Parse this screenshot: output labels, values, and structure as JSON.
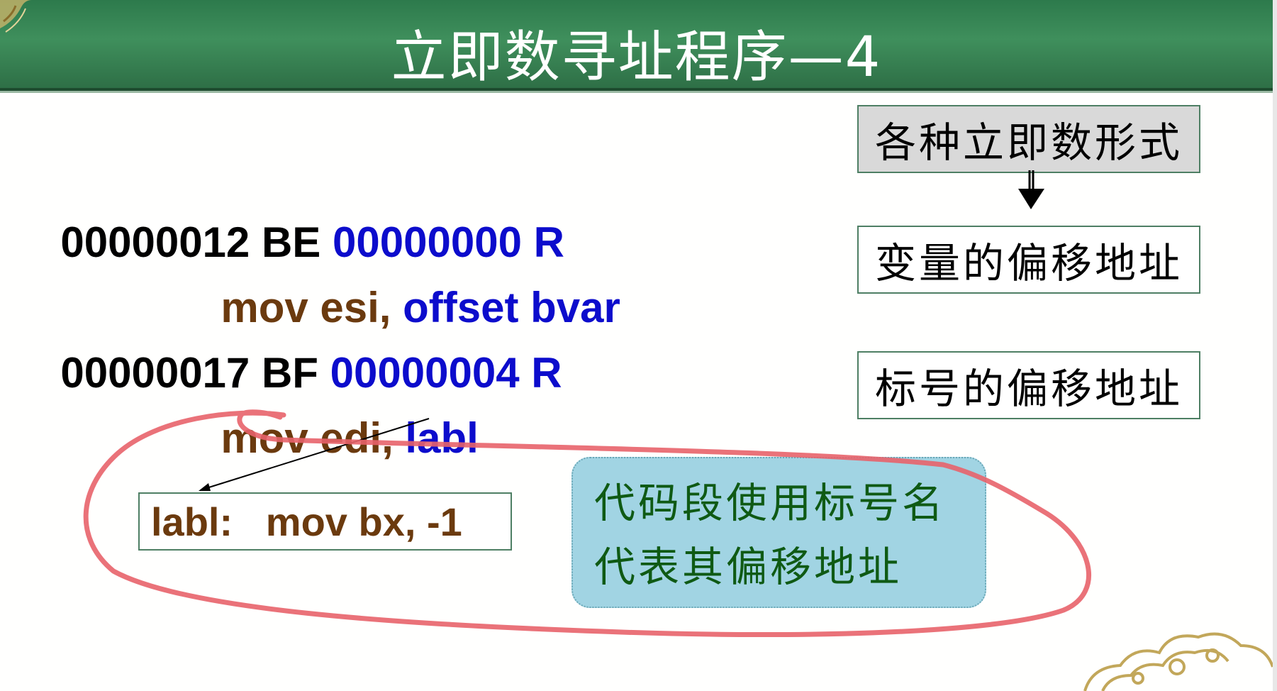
{
  "slide": {
    "title": "立即数寻址程序—4",
    "colors": {
      "title_bar": "#2d7a4c",
      "brown": "#6b3a0e",
      "blue": "#0c0ccc",
      "note_bg": "#a1d4e3",
      "ink": "#e8636a"
    }
  },
  "code_lines": [
    {
      "addr": "00000012 BE ",
      "operand": "00000000 R"
    },
    {
      "mnemonic": "mov esi, ",
      "operand": "offset bvar"
    },
    {
      "addr": "00000017 BF ",
      "operand": "00000004 R"
    },
    {
      "mnemonic": "mov edi, ",
      "operand": "labl"
    }
  ],
  "labels": {
    "immediate_forms": "各种立即数形式",
    "var_offset": "变量的偏移地址",
    "label_offset": "标号的偏移地址"
  },
  "label_code": "labl:   mov bx, -1",
  "note": {
    "line1": "代码段使用标号名",
    "line2": "代表其偏移地址"
  }
}
